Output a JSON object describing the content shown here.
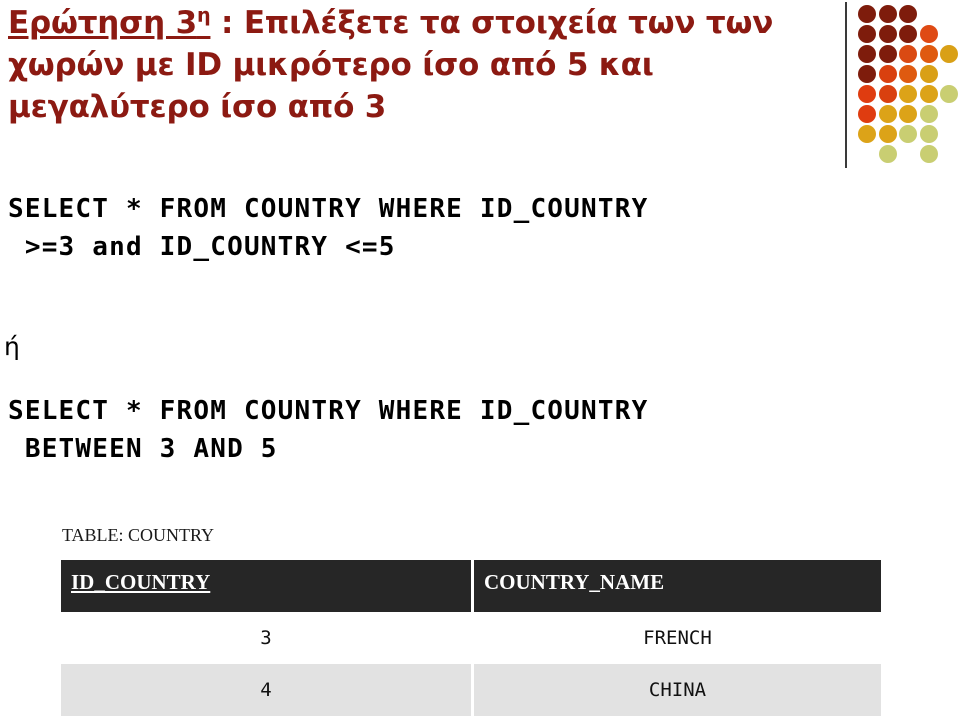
{
  "slide": {
    "title": {
      "question_label": "Ερώτηση 3",
      "question_ordinal_sup": "η",
      "separator": " : ",
      "body": "Επιλέξετε τα στοιχεία των των χωρών με ID μικρότερο ίσο από 5 και μεγαλύτερο ίσο από 3",
      "color": "#8C1A12"
    },
    "sql_statements": [
      {
        "id": "sql-1",
        "text": "SELECT * FROM COUNTRY WHERE ID_COUNTRY\n >=3 and ID_COUNTRY <=5"
      },
      {
        "id": "sql-2",
        "text": "SELECT * FROM COUNTRY WHERE ID_COUNTRY\n BETWEEN 3 AND 5"
      }
    ],
    "alternative_word": "ή",
    "table": {
      "caption": "TABLE: COUNTRY",
      "columns": [
        {
          "key": "id_country",
          "label": "ID_COUNTRY",
          "underlined": true
        },
        {
          "key": "country_name",
          "label": "COUNTRY_NAME",
          "underlined": false
        }
      ],
      "rows": [
        {
          "id_country": "3",
          "country_name": "FRENCH"
        },
        {
          "id_country": "4",
          "country_name": "CHINA"
        }
      ],
      "header_bg": "#262626",
      "header_fg": "#ffffff",
      "row_alt_bg": "#e2e2e2"
    },
    "decoration": {
      "divider_color": "#3a3a3a",
      "dot_palette": {
        "dark_red": "#8B1A0E",
        "red": "#C42A10",
        "orange_red": "#E0491A",
        "orange": "#E2731A",
        "gold": "#D9A016",
        "yellow": "#E0B41C",
        "light_olive": "#C9CE72",
        "pale_olive": "#CFD47E"
      },
      "dots": [
        {
          "name": "dot-r0c0",
          "col": 0,
          "row": 0,
          "color": "#7E1C0C"
        },
        {
          "name": "dot-r0c1",
          "col": 1,
          "row": 0,
          "color": "#7E1C0C"
        },
        {
          "name": "dot-r0c2",
          "col": 2,
          "row": 0,
          "color": "#7E1C0C"
        },
        {
          "name": "dot-r1c0",
          "col": 0,
          "row": 1,
          "color": "#7E1C0C"
        },
        {
          "name": "dot-r1c1",
          "col": 1,
          "row": 1,
          "color": "#7E1C0C"
        },
        {
          "name": "dot-r1c2",
          "col": 2,
          "row": 1,
          "color": "#7E1C0C"
        },
        {
          "name": "dot-r1c3",
          "col": 3,
          "row": 1,
          "color": "#DF4A14"
        },
        {
          "name": "dot-r2c0",
          "col": 0,
          "row": 2,
          "color": "#7E1C0C"
        },
        {
          "name": "dot-r2c1",
          "col": 1,
          "row": 2,
          "color": "#7E1C0C"
        },
        {
          "name": "dot-r2c2",
          "col": 2,
          "row": 2,
          "color": "#DA4A13"
        },
        {
          "name": "dot-r2c3",
          "col": 3,
          "row": 2,
          "color": "#DF5A10"
        },
        {
          "name": "dot-r2c4",
          "col": 4,
          "row": 2,
          "color": "#D9A016"
        },
        {
          "name": "dot-r3c0",
          "col": 0,
          "row": 3,
          "color": "#7E1C0C"
        },
        {
          "name": "dot-r3c1",
          "col": 1,
          "row": 3,
          "color": "#D9400F"
        },
        {
          "name": "dot-r3c2",
          "col": 2,
          "row": 3,
          "color": "#DF5A10"
        },
        {
          "name": "dot-r3c3",
          "col": 3,
          "row": 3,
          "color": "#D9A016"
        },
        {
          "name": "dot-r4c0",
          "col": 0,
          "row": 4,
          "color": "#DF3C10"
        },
        {
          "name": "dot-r4c1",
          "col": 1,
          "row": 4,
          "color": "#D9400F"
        },
        {
          "name": "dot-r4c2",
          "col": 2,
          "row": 4,
          "color": "#DCA318"
        },
        {
          "name": "dot-r4c3",
          "col": 3,
          "row": 4,
          "color": "#DCA318"
        },
        {
          "name": "dot-r4c4",
          "col": 4,
          "row": 4,
          "color": "#C9CE72"
        },
        {
          "name": "dot-r5c0",
          "col": 0,
          "row": 5,
          "color": "#DF3C10"
        },
        {
          "name": "dot-r5c1",
          "col": 1,
          "row": 5,
          "color": "#DCA318"
        },
        {
          "name": "dot-r5c2",
          "col": 2,
          "row": 5,
          "color": "#DCA318"
        },
        {
          "name": "dot-r5c3",
          "col": 3,
          "row": 5,
          "color": "#C9CE72"
        },
        {
          "name": "dot-r6c0",
          "col": 0,
          "row": 6,
          "color": "#DCA318"
        },
        {
          "name": "dot-r6c1",
          "col": 1,
          "row": 6,
          "color": "#DCA318"
        },
        {
          "name": "dot-r6c2",
          "col": 2,
          "row": 6,
          "color": "#C9CE72"
        },
        {
          "name": "dot-r6c3",
          "col": 3,
          "row": 6,
          "color": "#C9CE72"
        },
        {
          "name": "dot-r7c1",
          "col": 1,
          "row": 7,
          "color": "#C9CE72"
        },
        {
          "name": "dot-r7c3",
          "col": 3,
          "row": 7,
          "color": "#C9CE72"
        }
      ]
    }
  }
}
